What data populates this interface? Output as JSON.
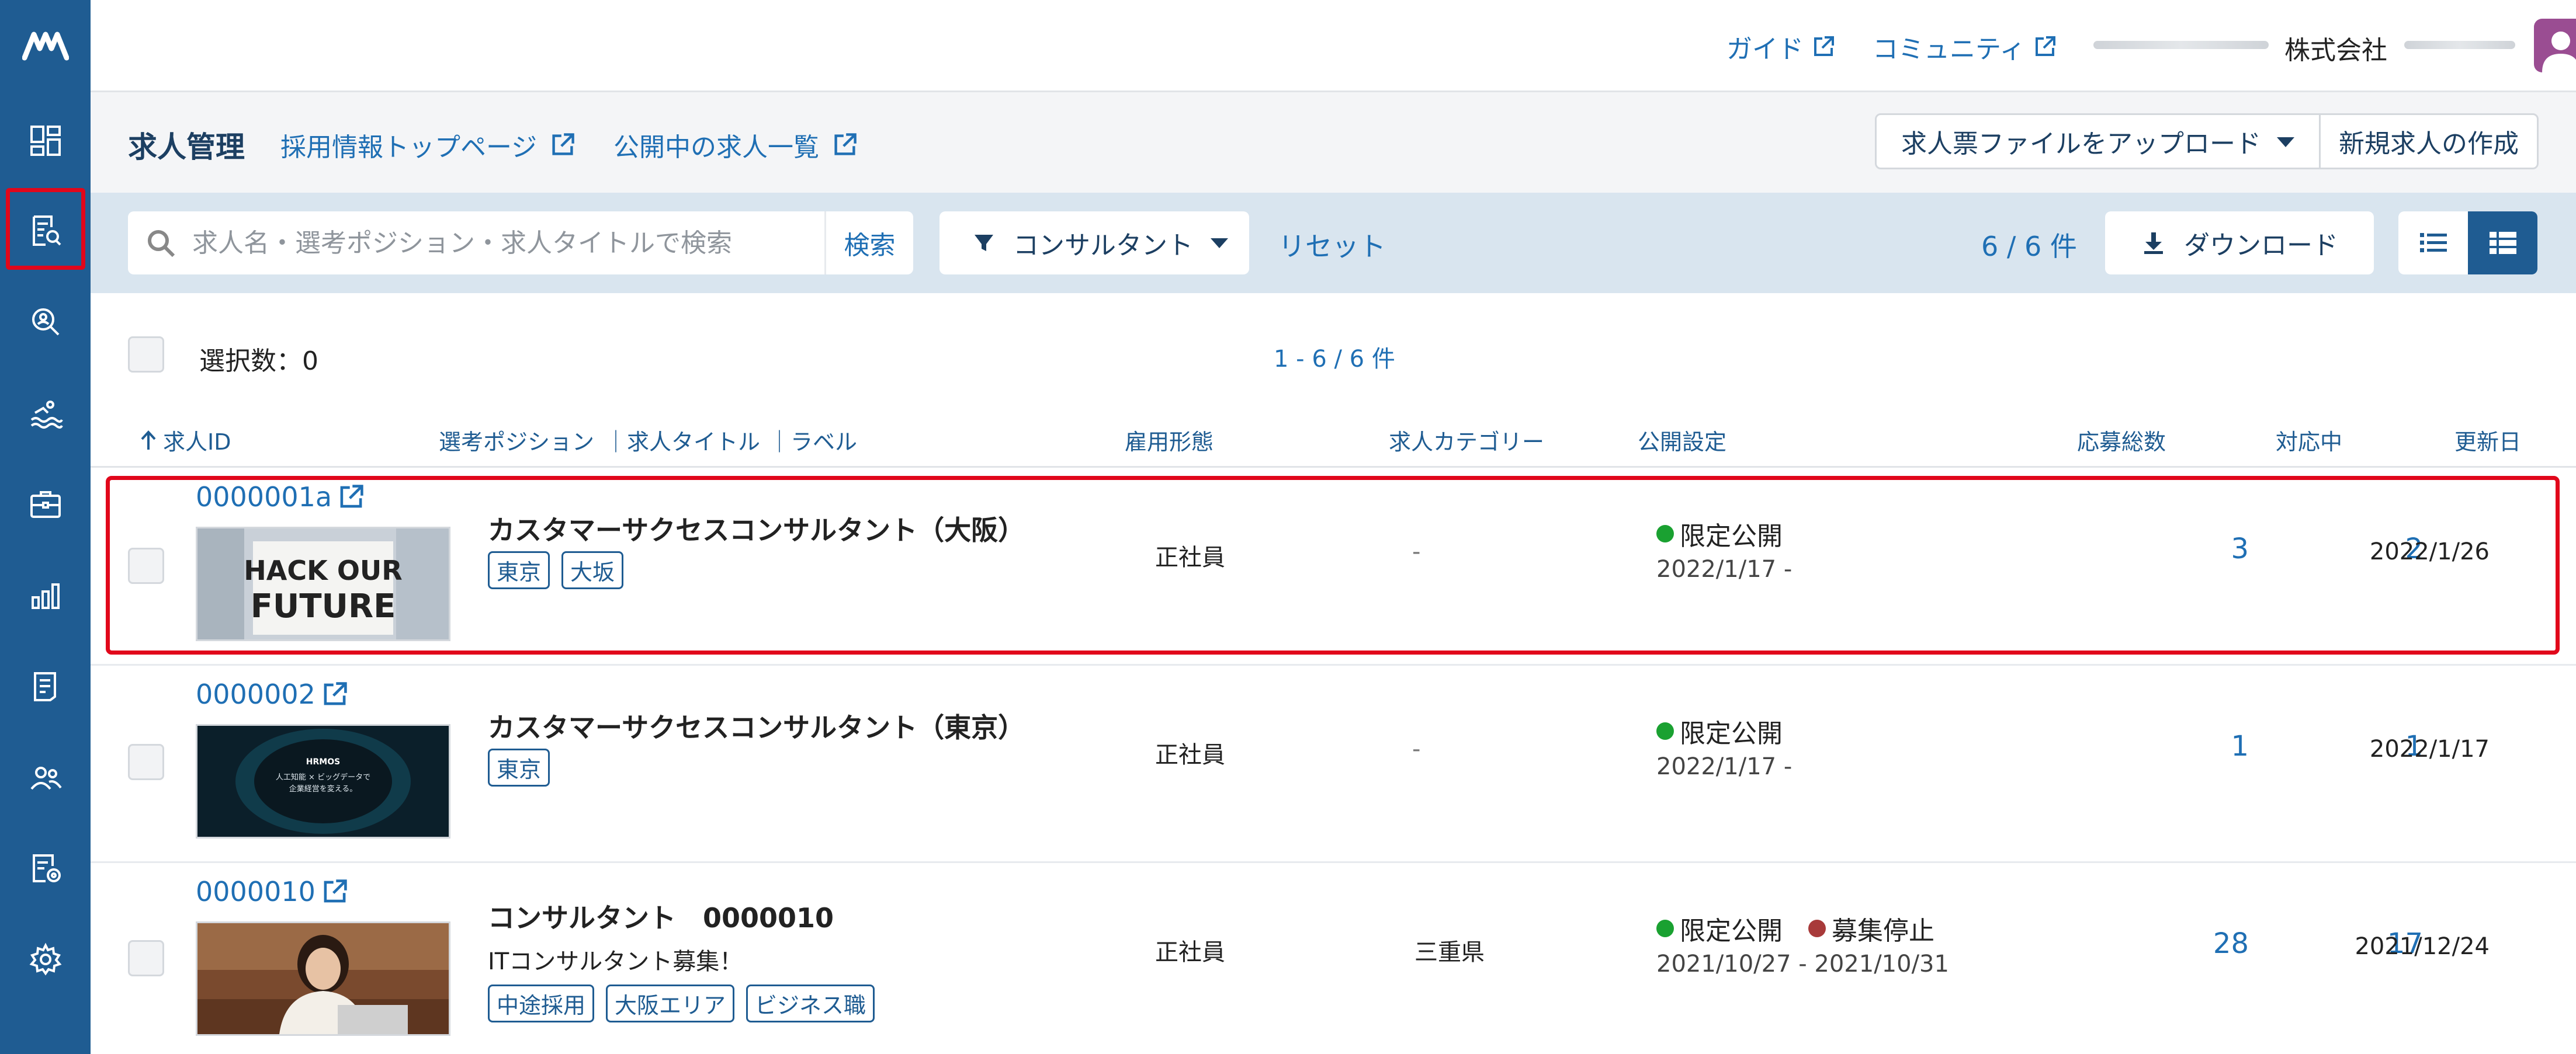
{
  "topbar": {
    "guide": "ガイド",
    "community": "コミュニティ",
    "company_label": "株式会社"
  },
  "header": {
    "title": "求人管理",
    "link_top": "採用情報トップページ",
    "link_public": "公開中の求人一覧",
    "upload_button": "求人票ファイルをアップロード",
    "new_button": "新規求人の作成"
  },
  "filter": {
    "search_placeholder": "求人名・選考ポジション・求人タイトルで検索",
    "search_button": "検索",
    "consultant_filter": "コンサルタント",
    "reset": "リセット",
    "count": "6 / 6 件",
    "download": "ダウンロード"
  },
  "list": {
    "selected": "選択数：0",
    "range": "1 - 6 / 6 件",
    "columns": {
      "id": "求人ID",
      "position": "選考ポジション",
      "job_title": "｜求人タイトル",
      "label": "｜ラベル",
      "employment": "雇用形態",
      "category": "求人カテゴリー",
      "publish": "公開設定",
      "applicants": "応募総数",
      "in_progress": "対応中",
      "updated": "更新日"
    },
    "rows": [
      {
        "id": "0000001a",
        "thumb_text": [
          "HACK OUR",
          "FUTURE"
        ],
        "title": "カスタマーサクセスコンサルタント（大阪）",
        "subtitle": "",
        "tags": [
          "東京",
          "大坂"
        ],
        "employment": "正社員",
        "category": "-",
        "status": "限定公開",
        "status_color": "#1aa131",
        "status2": "",
        "period": "2022/1/17 -",
        "applicants": "3",
        "in_progress": "2",
        "updated": "2022/1/26"
      },
      {
        "id": "0000002",
        "thumb_text": [
          "HRMOS",
          "人工知能 × ビッグデータで",
          "企業経営を変える。"
        ],
        "title": "カスタマーサクセスコンサルタント（東京）",
        "subtitle": "",
        "tags": [
          "東京"
        ],
        "employment": "正社員",
        "category": "-",
        "status": "限定公開",
        "status_color": "#1aa131",
        "status2": "",
        "period": "2022/1/17 -",
        "applicants": "1",
        "in_progress": "1",
        "updated": "2022/1/17"
      },
      {
        "id": "0000010",
        "thumb_text": [],
        "title": "コンサルタント　0000010",
        "subtitle": "ITコンサルタント募集！",
        "tags": [
          "中途採用",
          "大阪エリア",
          "ビジネス職"
        ],
        "employment": "正社員",
        "category": "三重県",
        "status": "限定公開",
        "status_color": "#1aa131",
        "status2": "募集停止",
        "status2_color": "#a83a3a",
        "period": "2021/10/27 - 2021/10/31",
        "applicants": "28",
        "in_progress": "17",
        "updated": "2021/12/24"
      }
    ]
  },
  "colors": {
    "sidebar": "#1f5c92",
    "link": "#1f6fb4",
    "highlight": "#e1071b",
    "filterbar": "#d9e5ef"
  }
}
